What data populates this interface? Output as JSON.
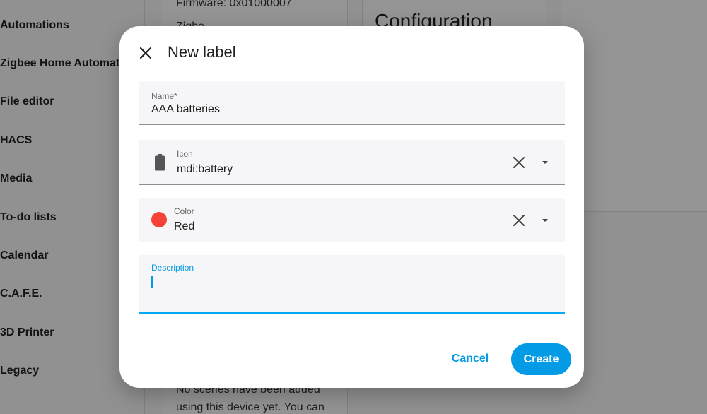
{
  "sidebar": {
    "items": [
      {
        "label": "Automations"
      },
      {
        "label": "Zigbee Home Automation"
      },
      {
        "label": "File editor"
      },
      {
        "label": "HACS"
      },
      {
        "label": "Media"
      },
      {
        "label": "To-do lists"
      },
      {
        "label": "Calendar"
      },
      {
        "label": "C.A.F.E."
      },
      {
        "label": "3D Printer"
      },
      {
        "label": "Legacy"
      }
    ]
  },
  "background": {
    "firmware_text": "Firmware: 0x01000007",
    "zigbee_text": "Zigbe",
    "config_heading": "Configuration",
    "scenes_line1": "No scenes have been added",
    "scenes_line2": "using this device yet. You can"
  },
  "dialog": {
    "title": "New label",
    "close_icon": "close-icon",
    "name_field": {
      "label": "Name*",
      "value": "AAA batteries"
    },
    "icon_field": {
      "label": "Icon",
      "value": "mdi:battery",
      "icon": "battery-icon"
    },
    "color_field": {
      "label": "Color",
      "value": "Red",
      "swatch_color": "#f44336"
    },
    "description_field": {
      "label": "Description",
      "value": ""
    },
    "cancel_label": "Cancel",
    "create_label": "Create",
    "accent_color": "#039be5"
  }
}
